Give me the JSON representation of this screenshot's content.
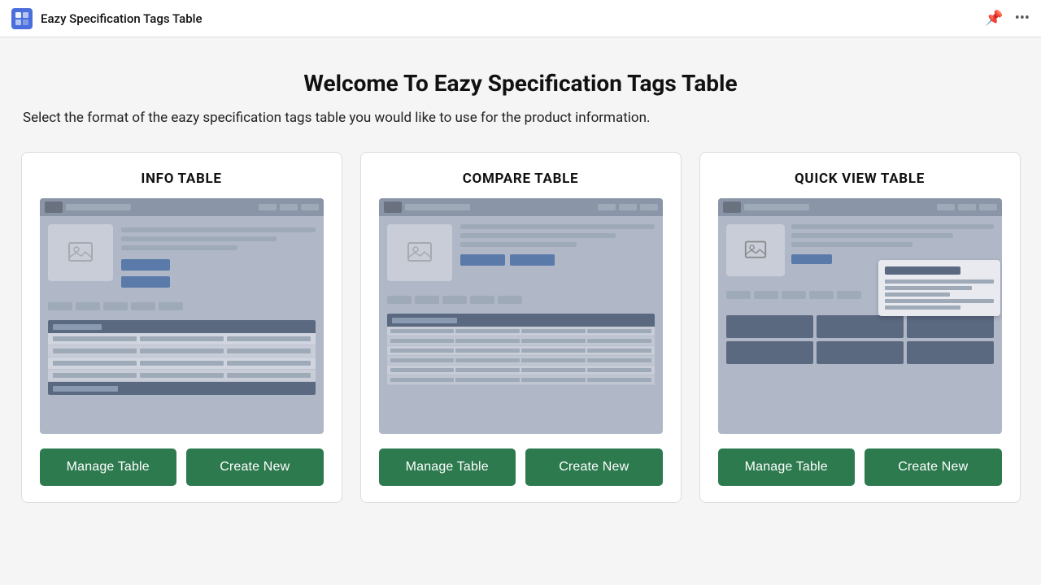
{
  "topbar": {
    "title": "Eazy Specification Tags Table",
    "app_icon_label": "app-icon"
  },
  "main": {
    "page_title": "Welcome To Eazy Specification Tags Table",
    "subtitle": "Select the format of the eazy specification tags table you would like to use for the product information.",
    "cards": [
      {
        "id": "info-table",
        "title": "INFO TABLE",
        "manage_label": "Manage Table",
        "create_label": "Create New"
      },
      {
        "id": "compare-table",
        "title": "COMPARE TABLE",
        "manage_label": "Manage Table",
        "create_label": "Create New"
      },
      {
        "id": "quick-view-table",
        "title": "QUICK VIEW TABLE",
        "manage_label": "Manage Table",
        "create_label": "Create New"
      }
    ]
  }
}
